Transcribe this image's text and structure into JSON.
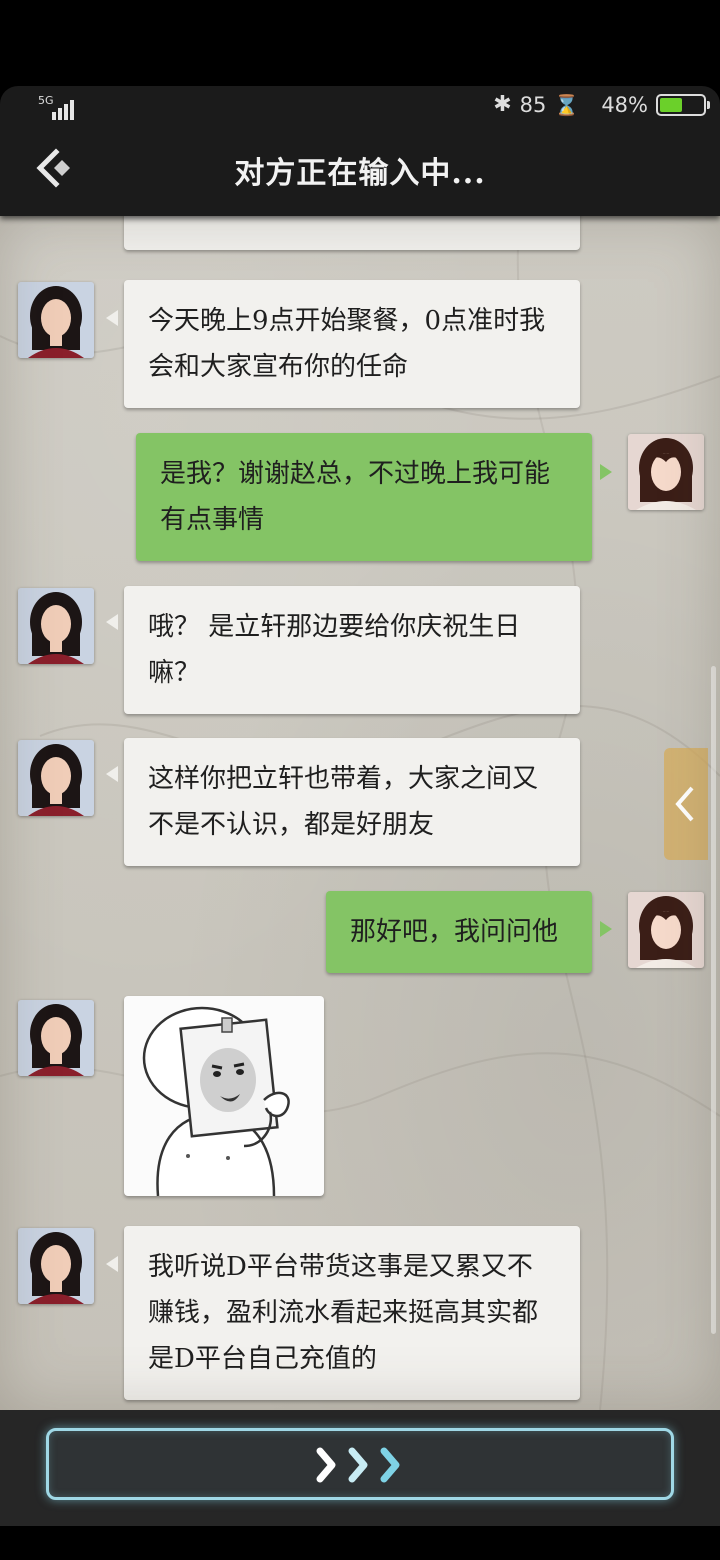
{
  "status_bar": {
    "network": "5G",
    "number": "85",
    "battery_text": "48%",
    "battery_level": 0.48,
    "icons": [
      "signal-icon",
      "bluetooth-icon",
      "hourglass-icon",
      "battery-icon"
    ]
  },
  "header": {
    "title": "对方正在输入中..."
  },
  "messages": {
    "m1": "今天晚上9点开始聚餐，0点准时我会和大家宣布你的任命",
    "m2": "是我？谢谢赵总，不过晚上我可能有点事情",
    "m3": "哦？ 是立轩那边要给你庆祝生日嘛？",
    "m4": "这样你把立轩也带着，大家之间又不是不认识，都是好朋友",
    "m5": "那好吧，我问问他",
    "m6_sticker": "sticker-image",
    "m7": "我听说D平台带货这事是又累又不赚钱，盈利流水看起来挺高其实都是D平台自己充值的"
  },
  "footer": {
    "next_button_icon": "triple-chevron-right-icon"
  },
  "colors": {
    "incoming_bubble": "#f2f1ee",
    "outgoing_bubble": "#84c465",
    "button_glow": "#9fd8e6"
  }
}
